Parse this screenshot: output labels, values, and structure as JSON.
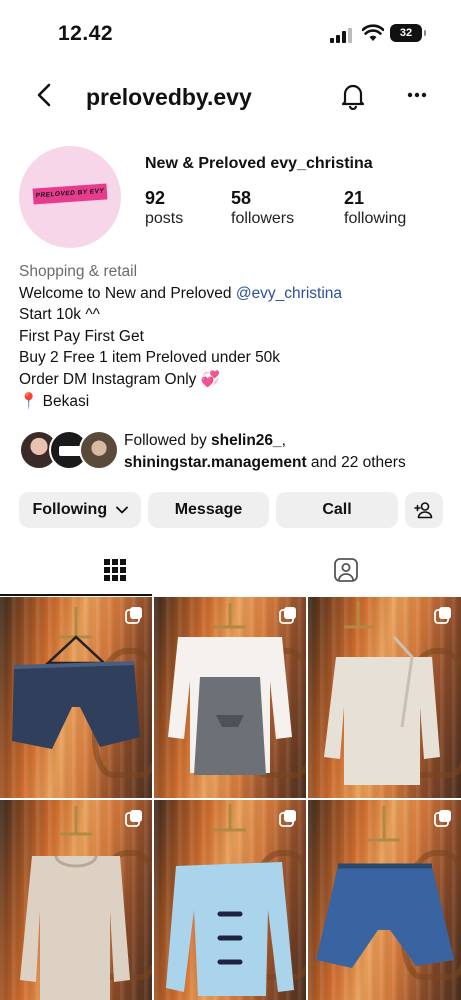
{
  "status_bar": {
    "time": "12.42",
    "battery": "32"
  },
  "header": {
    "username": "prelovedby.evy",
    "icons": [
      "back-arrow-icon",
      "bell-icon",
      "more-icon"
    ]
  },
  "profile": {
    "full_name": "New & Preloved evy_christina",
    "stats": [
      {
        "value": "92",
        "label": "posts"
      },
      {
        "value": "58",
        "label": "followers"
      },
      {
        "value": "21",
        "label": "following"
      }
    ],
    "avatar_logo_text": "PRELOVED BY EVY",
    "bio": {
      "category": "Shopping & retail",
      "line1_text": "Welcome to New and Preloved ",
      "line1_mention": "@evy_christina",
      "line2": "Start 10k ^^",
      "line3": "First Pay First Get",
      "line4": "Buy 2 Free 1 item Preloved under 50k",
      "line5": "Order DM Instagram Only",
      "line5_emoji": "💞",
      "line6_icon": "📍",
      "line6": " Bekasi"
    },
    "followed_by": {
      "prefix": "Followed by ",
      "user1": "shelin26_",
      "sep": ",",
      "user2": "shiningstar.management",
      "suffix": " and 22 others"
    }
  },
  "actions": {
    "following": "Following",
    "message": "Message",
    "call": "Call"
  },
  "tabs": [
    {
      "name": "grid",
      "icon": "grid-icon",
      "active": true
    },
    {
      "name": "tagged",
      "icon": "tagged-icon",
      "active": false
    }
  ],
  "posts": [
    {
      "item": "denim shorts",
      "color": "#2f3f5c"
    },
    {
      "item": "white top with grey vest",
      "color": "#6d7077"
    },
    {
      "item": "cream hoodie",
      "color": "#e6e0d6"
    },
    {
      "item": "beige sweater",
      "color": "#ddd1c4"
    },
    {
      "item": "light blue bow top",
      "color": "#a9d4ec"
    },
    {
      "item": "denim skirt shorts",
      "color": "#3a64a1"
    }
  ],
  "colors": {
    "accent_mention": "#2c4f9e",
    "button_bg": "#efefef",
    "category_grey": "#6b6b6b"
  }
}
